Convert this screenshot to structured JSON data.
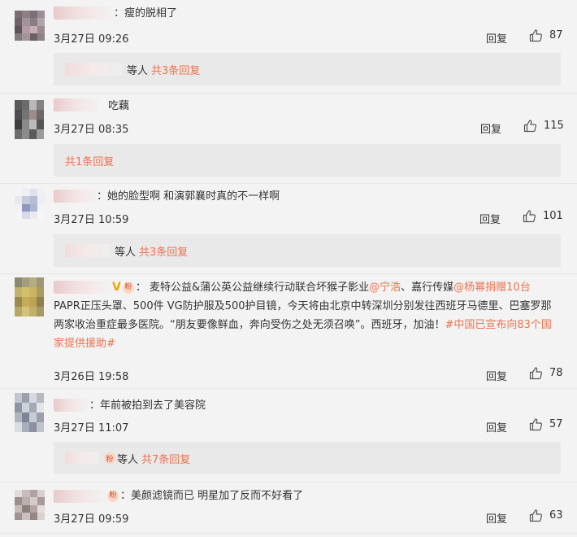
{
  "comments": [
    {
      "text": "：瘦的脱相了",
      "time": "3月27日 09:26",
      "reply_label": "回复",
      "likes": "87",
      "sub": {
        "who": "等人",
        "more": "共3条回复"
      }
    },
    {
      "text": "吃藕",
      "time": "3月27日 08:35",
      "reply_label": "回复",
      "likes": "115",
      "sub": {
        "more": "共1条回复"
      }
    },
    {
      "text": "：她的脸型啊 和演郭襄时真的不一样啊",
      "time": "3月27日 10:59",
      "reply_label": "回复",
      "likes": "101",
      "sub": {
        "who": "等人",
        "more": "共3条回复"
      }
    },
    {
      "text_parts": [
        "：  麦特公益&蒲公英公益继续行动联合坏猴子影业",
        "@宁浩",
        "、嘉行传媒",
        "@杨幂捐赠10台",
        " PAPR正压头罩、500件 VG防护服及500护目镜，今天将由北京中转深圳分别发往西班牙马德里、巴塞罗那两家收治重症最多医院。“朋友要像鲜血，奔向受伤之处无须召唤”。西班牙，加油！",
        "#中国已宣布向83个国家提供援助#"
      ],
      "time": "3月26日 19:58",
      "reply_label": "回复",
      "likes": "78"
    },
    {
      "text": "：年前被拍到去了美容院",
      "time": "3月27日 11:07",
      "reply_label": "回复",
      "likes": "57",
      "sub": {
        "who": "等人",
        "more": "共7条回复"
      }
    },
    {
      "text": "：美颜滤镜而已 明星加了反而不好看了",
      "time": "3月27日 09:59",
      "reply_label": "回复",
      "likes": "63"
    }
  ],
  "icons": {
    "like": "thumbs-up-icon",
    "vip": "v-badge-icon",
    "fan": "fan-badge-icon"
  },
  "colors": {
    "accent": "#eb7350",
    "background": "#f3f3f3",
    "reply_bg": "#e9e9e9"
  }
}
